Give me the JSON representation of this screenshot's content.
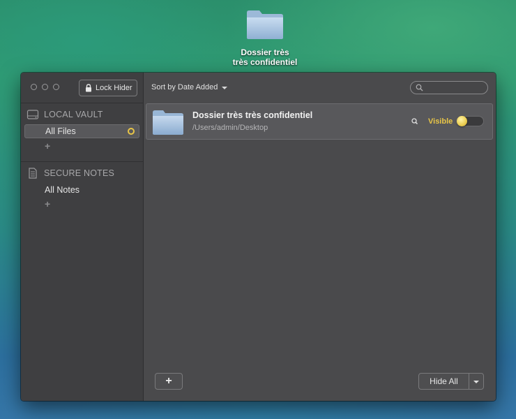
{
  "desktop": {
    "icon_label_line1": "Dossier très",
    "icon_label_line2": "très confidentiel"
  },
  "toolbar": {
    "lock_label": "Lock Hider",
    "sort_label": "Sort by Date Added",
    "search_placeholder": ""
  },
  "sidebar": {
    "vault_header": "LOCAL VAULT",
    "all_files": "All Files",
    "notes_header": "SECURE NOTES",
    "all_notes": "All Notes",
    "add_symbol": "+"
  },
  "files": [
    {
      "name": "Dossier très très confidentiel",
      "path": "/Users/admin/Desktop",
      "status": "Visible",
      "toggle_on": true
    }
  ],
  "footer": {
    "add_label": "+",
    "hide_all_label": "Hide All"
  },
  "colors": {
    "accent": "#e8c547",
    "window_bg": "#4a4a4c",
    "sidebar_bg": "#3f3f41"
  },
  "icons": [
    "folder-icon",
    "lock-icon",
    "disk-icon",
    "note-icon",
    "search-icon",
    "chevron-down-icon"
  ]
}
